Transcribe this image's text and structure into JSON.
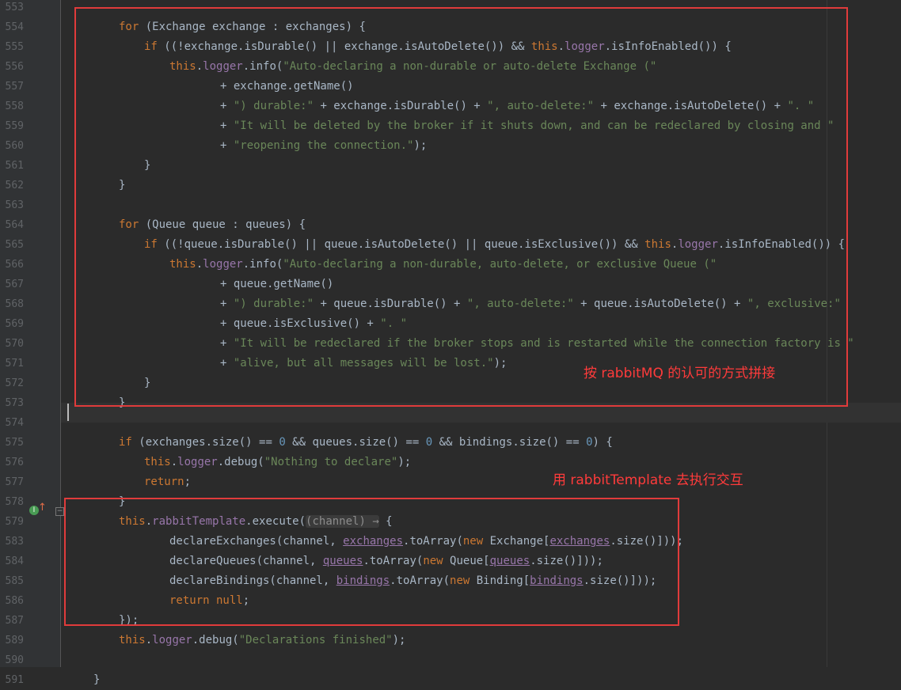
{
  "editor": {
    "line_numbers": [
      "553",
      "554",
      "555",
      "556",
      "557",
      "558",
      "559",
      "560",
      "561",
      "562",
      "563",
      "564",
      "565",
      "566",
      "567",
      "568",
      "569",
      "570",
      "571",
      "572",
      "573",
      "574",
      "575",
      "576",
      "577",
      "578",
      "579",
      "583",
      "584",
      "585",
      "586",
      "587",
      "589",
      "590",
      "591"
    ],
    "lines": [
      [],
      [
        [
          "kw",
          "for "
        ],
        [
          "p",
          "(Exchange exchange : exchanges) {"
        ]
      ],
      [
        [
          "kw",
          "if "
        ],
        [
          "p",
          "((!exchange.isDurable() || exchange.isAutoDelete()) && "
        ],
        [
          "kw",
          "this"
        ],
        [
          "p",
          "."
        ],
        [
          "fld",
          "logger"
        ],
        [
          "p",
          ".isInfoEnabled()) {"
        ]
      ],
      [
        [
          "kw",
          "this"
        ],
        [
          "p",
          "."
        ],
        [
          "fld",
          "logger"
        ],
        [
          "p",
          ".info("
        ],
        [
          "str",
          "\"Auto-declaring a non-durable or auto-delete Exchange (\""
        ]
      ],
      [
        [
          "p",
          "+ exchange.getName()"
        ]
      ],
      [
        [
          "p",
          "+ "
        ],
        [
          "str",
          "\") durable:\""
        ],
        [
          "p",
          " + exchange.isDurable() + "
        ],
        [
          "str",
          "\", auto-delete:\""
        ],
        [
          "p",
          " + exchange.isAutoDelete() + "
        ],
        [
          "str",
          "\". \""
        ]
      ],
      [
        [
          "p",
          "+ "
        ],
        [
          "str",
          "\"It will be deleted by the broker if it shuts down, and can be redeclared by closing and \""
        ]
      ],
      [
        [
          "p",
          "+ "
        ],
        [
          "str",
          "\"reopening the connection.\""
        ],
        [
          "p",
          ");"
        ]
      ],
      [
        [
          "p",
          "}"
        ]
      ],
      [
        [
          "p",
          "}"
        ]
      ],
      [],
      [
        [
          "kw",
          "for "
        ],
        [
          "p",
          "(Queue queue : queues) {"
        ]
      ],
      [
        [
          "kw",
          "if "
        ],
        [
          "p",
          "((!queue.isDurable() || queue.isAutoDelete() || queue.isExclusive()) && "
        ],
        [
          "kw",
          "this"
        ],
        [
          "p",
          "."
        ],
        [
          "fld",
          "logger"
        ],
        [
          "p",
          ".isInfoEnabled()) {"
        ]
      ],
      [
        [
          "kw",
          "this"
        ],
        [
          "p",
          "."
        ],
        [
          "fld",
          "logger"
        ],
        [
          "p",
          ".info("
        ],
        [
          "str",
          "\"Auto-declaring a non-durable, auto-delete, or exclusive Queue (\""
        ]
      ],
      [
        [
          "p",
          "+ queue.getName()"
        ]
      ],
      [
        [
          "p",
          "+ "
        ],
        [
          "str",
          "\") durable:\""
        ],
        [
          "p",
          " + queue.isDurable() + "
        ],
        [
          "str",
          "\", auto-delete:\""
        ],
        [
          "p",
          " + queue.isAutoDelete() + "
        ],
        [
          "str",
          "\", exclusive:\""
        ]
      ],
      [
        [
          "p",
          "+ queue.isExclusive() + "
        ],
        [
          "str",
          "\". \""
        ]
      ],
      [
        [
          "p",
          "+ "
        ],
        [
          "str",
          "\"It will be redeclared if the broker stops and is restarted while the connection factory is \""
        ]
      ],
      [
        [
          "p",
          "+ "
        ],
        [
          "str",
          "\"alive, but all messages will be lost.\""
        ],
        [
          "p",
          ");"
        ]
      ],
      [
        [
          "p",
          "}"
        ]
      ],
      [
        [
          "p",
          "}"
        ]
      ],
      [],
      [
        [
          "kw",
          "if "
        ],
        [
          "p",
          "(exchanges.size() == "
        ],
        [
          "num",
          "0"
        ],
        [
          "p",
          " && queues.size() == "
        ],
        [
          "num",
          "0"
        ],
        [
          "p",
          " && bindings.size() == "
        ],
        [
          "num",
          "0"
        ],
        [
          "p",
          ") {"
        ]
      ],
      [
        [
          "kw",
          "this"
        ],
        [
          "p",
          "."
        ],
        [
          "fld",
          "logger"
        ],
        [
          "p",
          ".debug("
        ],
        [
          "str",
          "\"Nothing to declare\""
        ],
        [
          "p",
          ");"
        ]
      ],
      [
        [
          "kw",
          "return"
        ],
        [
          "p",
          ";"
        ]
      ],
      [
        [
          "p",
          "}"
        ]
      ],
      [
        [
          "kw",
          "this"
        ],
        [
          "p",
          "."
        ],
        [
          "fld",
          "rabbitTemplate"
        ],
        [
          "p",
          ".execute("
        ],
        [
          "hint",
          "(channel) →"
        ],
        [
          "p",
          " {"
        ]
      ],
      [
        [
          "p",
          "declareExchanges(channel, "
        ],
        [
          "u",
          "exchanges"
        ],
        [
          "p",
          ".toArray("
        ],
        [
          "kw",
          "new "
        ],
        [
          "p",
          "Exchange["
        ],
        [
          "u",
          "exchanges"
        ],
        [
          "p",
          ".size()]));"
        ]
      ],
      [
        [
          "p",
          "declareQueues(channel, "
        ],
        [
          "u",
          "queues"
        ],
        [
          "p",
          ".toArray("
        ],
        [
          "kw",
          "new "
        ],
        [
          "p",
          "Queue["
        ],
        [
          "u",
          "queues"
        ],
        [
          "p",
          ".size()]));"
        ]
      ],
      [
        [
          "p",
          "declareBindings(channel, "
        ],
        [
          "u",
          "bindings"
        ],
        [
          "p",
          ".toArray("
        ],
        [
          "kw",
          "new "
        ],
        [
          "p",
          "Binding["
        ],
        [
          "u",
          "bindings"
        ],
        [
          "p",
          ".size()]));"
        ]
      ],
      [
        [
          "kw",
          "return null"
        ],
        [
          "p",
          ";"
        ]
      ],
      [
        [
          "p",
          "});"
        ]
      ],
      [
        [
          "kw",
          "this"
        ],
        [
          "p",
          "."
        ],
        [
          "fld",
          "logger"
        ],
        [
          "p",
          ".debug("
        ],
        [
          "str",
          "\"Declarations finished\""
        ],
        [
          "p",
          ");"
        ]
      ],
      [],
      [
        [
          "p",
          "}"
        ]
      ]
    ]
  },
  "annotations": {
    "note_top": "按 rabbitMQ 的认可的方式拼接",
    "note_bottom": "用 rabbitTemplate 去执行交互"
  },
  "colors": {
    "background": "#2b2b2b",
    "keyword": "#cc7832",
    "field": "#9876aa",
    "string": "#6a8759",
    "number": "#6897bb",
    "annotation": "#e03b3b"
  },
  "gutter_icons": [
    "implementation-icon",
    "override-arrow-icon",
    "fold-icon"
  ]
}
